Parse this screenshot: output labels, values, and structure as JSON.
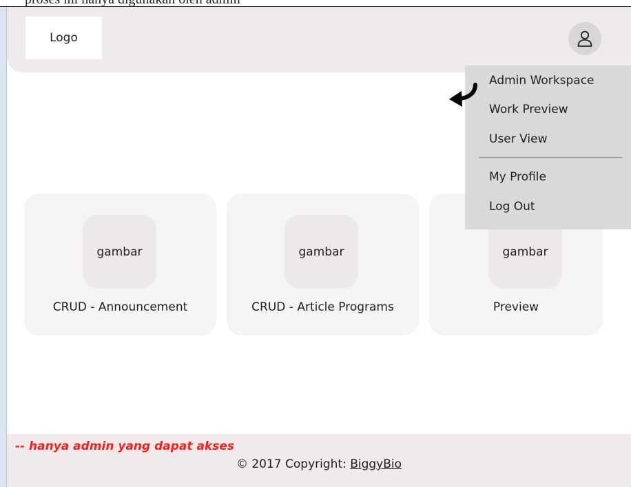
{
  "top_strip_text": "proses ini hanya digunakan oleh admin",
  "header": {
    "logo_label": "Logo"
  },
  "user_menu": {
    "items": [
      {
        "label": "Admin Workspace"
      },
      {
        "label": "Work Preview"
      },
      {
        "label": "User View"
      },
      {
        "label": "My Profile"
      },
      {
        "label": "Log Out"
      }
    ]
  },
  "cards": [
    {
      "image_label": "gambar",
      "title": "CRUD - Announcement"
    },
    {
      "image_label": "gambar",
      "title": "CRUD - Article Programs"
    },
    {
      "image_label": "gambar",
      "title": "Preview"
    }
  ],
  "footer": {
    "admin_note": "-- hanya admin yang dapat akses",
    "copyright_prefix": "© 2017 Copyright: ",
    "brand_link": "BiggyBio"
  },
  "colors": {
    "header_bg": "#f0eaea",
    "dropdown_bg": "#d9d9d9",
    "card_bg": "#f4f4f4",
    "note_red": "#ff1a1a",
    "left_rail": "#dde4f1"
  }
}
